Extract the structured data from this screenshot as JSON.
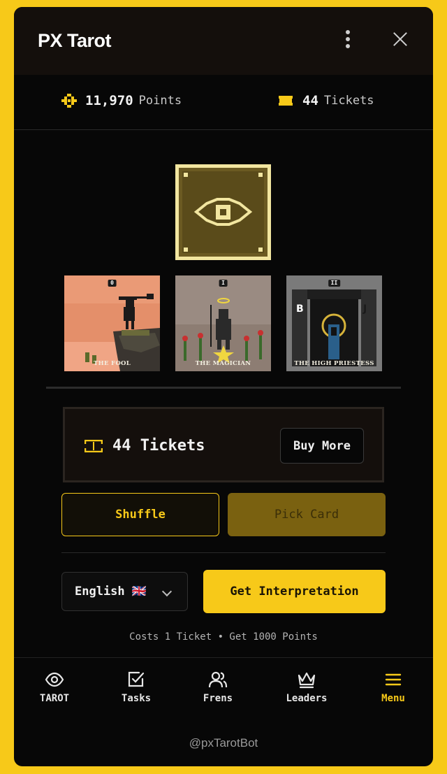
{
  "window": {
    "title": "PX Tarot"
  },
  "stats": {
    "points_value": "11,970",
    "points_unit": "Points",
    "tickets_value": "44",
    "tickets_unit": "Tickets"
  },
  "cards": [
    {
      "number": "0",
      "name": "THE FOOL"
    },
    {
      "number": "I",
      "name": "THE MAGICIAN"
    },
    {
      "number": "II",
      "name": "THE HIGH PRIESTESS"
    }
  ],
  "ticket_panel": {
    "count_label": "44 Tickets",
    "buy_label": "Buy More"
  },
  "actions": {
    "shuffle_label": "Shuffle",
    "pick_label": "Pick Card"
  },
  "language": {
    "selected": "English 🇬🇧"
  },
  "interpret": {
    "label": "Get Interpretation",
    "cost_note": "Costs 1 Ticket • Get 1000 Points"
  },
  "tabs": [
    {
      "label": "TAROT",
      "icon": "eye-icon"
    },
    {
      "label": "Tasks",
      "icon": "checkbox-icon"
    },
    {
      "label": "Frens",
      "icon": "users-icon"
    },
    {
      "label": "Leaders",
      "icon": "crown-icon"
    },
    {
      "label": "Menu",
      "icon": "hamburger-icon"
    }
  ],
  "footer": {
    "handle": "@pxTarotBot"
  },
  "colors": {
    "accent": "#f7c919",
    "background": "#070707",
    "page": "#f7c919"
  }
}
